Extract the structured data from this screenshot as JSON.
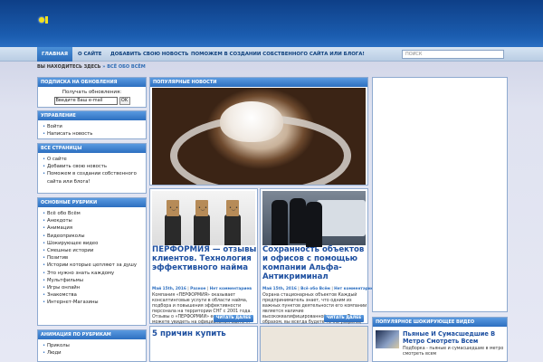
{
  "nav": {
    "items": [
      "Главная",
      "О сайте",
      "Добавить свою новость",
      "Поможем в создании собственного сайта или блога!"
    ],
    "search_placeholder": "ПОИСК"
  },
  "breadcrumb": {
    "prefix": "ВЫ НАХОДИТЕСЬ ЗДЕСЬ",
    "sep": "»",
    "current": "Всё обо Всём"
  },
  "sidebar": {
    "subscribe": {
      "title": "Подписка на обновления",
      "text": "Получать обновления:",
      "email_placeholder": "Введите Ваш e-mail",
      "ok_label": "OK"
    },
    "manage": {
      "title": "Управление",
      "items": [
        "Войти",
        "Написать новость"
      ]
    },
    "pages": {
      "title": "Все страницы",
      "items": [
        "О сайте",
        "Добавить свою новость",
        "Поможем в создании собственного сайта или блога!"
      ]
    },
    "rubrics": {
      "title": "Основные рубрики",
      "items": [
        "Всё обо Всём",
        "Анекдоты",
        "Анимация",
        "Видеоприколы",
        "Шокирующее видео",
        "Смешные истории",
        "Позитив",
        "Истории которые цепляют за душу",
        "Это нужно знать каждому",
        "Мультфильмы",
        "Игры онлайн",
        "Знакомства",
        "Интернет-Магазины"
      ]
    },
    "animation": {
      "title": "Анимация по рубрикам",
      "items": [
        "Приколы",
        "Люди"
      ]
    }
  },
  "popular": {
    "title": "Популярные новости"
  },
  "cards": [
    {
      "title": "ПЕРФОРМИЯ — отзывы клиентов. Технология эффективного найма",
      "date": "Май 15th, 2016",
      "sep1": " | ",
      "category": "Разное",
      "sep2": " | ",
      "comments": "Нет комментариев",
      "text": "Компания «ПЕРФОРМИЯ» оказывает консалтинговые услуги в области найма, подбора и повышения эффективности персонала на территории СНГ с 2001 года. Отзывы о «ПЕРФОРМИИ» ее клиентов вы можете увидеть на официальном сайте ...",
      "more": "Читать далее"
    },
    {
      "title": "Сохранность объектов и офисов с помощью компании Альфа-Антикриминал",
      "date": "Май 15th, 2016",
      "sep1": " | ",
      "category": "Всё обо Всём",
      "sep2": " | ",
      "comments": "Нет комментариев",
      "text": "Охрана стационарных объектов Каждый предприниматель знает, что одним из важных пунктов деятельности его компании является наличие высококвалифицированной охраны. Таким образом, вы всегда будете точно уверены, что все ваше имущество находится под ...",
      "more": "Читать далее"
    }
  ],
  "card_next": {
    "title": "5 причин купить"
  },
  "video": {
    "title": "Популярное шокирующее видео",
    "item_title": "Пьяные И Сумасшедшие В Метро Смотреть Всем",
    "item_text": "Подборка - пьяные и сумасшедшие в метро смотреть всем"
  }
}
